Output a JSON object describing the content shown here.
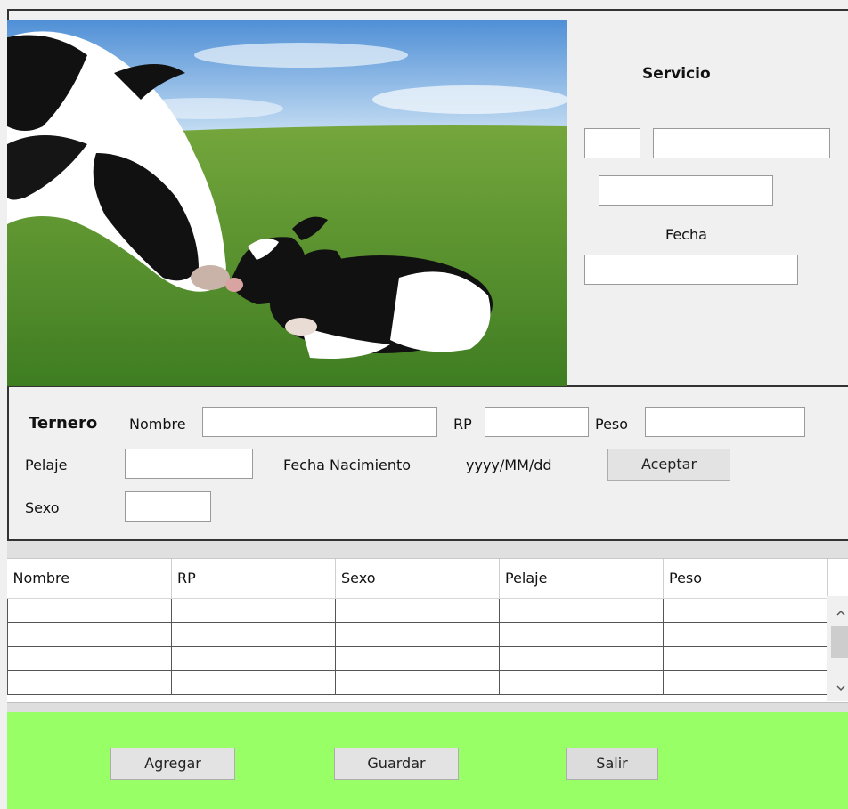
{
  "servicio": {
    "title": "Servicio",
    "fecha_label": "Fecha",
    "field_1": "",
    "field_2": "",
    "field_3": "",
    "fecha_value": ""
  },
  "photo": {
    "description_icon": "cow-and-calf-image"
  },
  "ternero": {
    "title": "Ternero",
    "nombre_label": "Nombre",
    "nombre_value": "",
    "rp_label": "RP",
    "rp_value": "",
    "peso_label": "Peso",
    "peso_value": "",
    "pelaje_label": "Pelaje",
    "pelaje_value": "",
    "fecha_nacimiento_label": "Fecha Nacimiento",
    "fecha_format": "yyyy/MM/dd",
    "aceptar_label": "Aceptar",
    "sexo_label": "Sexo",
    "sexo_value": ""
  },
  "grid": {
    "columns": [
      "Nombre",
      "RP",
      "Sexo",
      "Pelaje",
      "Peso"
    ],
    "rows": [
      [
        "",
        "",
        "",
        "",
        ""
      ],
      [
        "",
        "",
        "",
        "",
        ""
      ],
      [
        "",
        "",
        "",
        "",
        ""
      ],
      [
        "",
        "",
        "",
        "",
        ""
      ]
    ],
    "scroll_up_icon": "chevron-up-icon",
    "scroll_down_icon": "chevron-down-icon"
  },
  "footer": {
    "agregar_label": "Agregar",
    "guardar_label": "Guardar",
    "salir_label": "Salir",
    "background": "#99ff66"
  }
}
